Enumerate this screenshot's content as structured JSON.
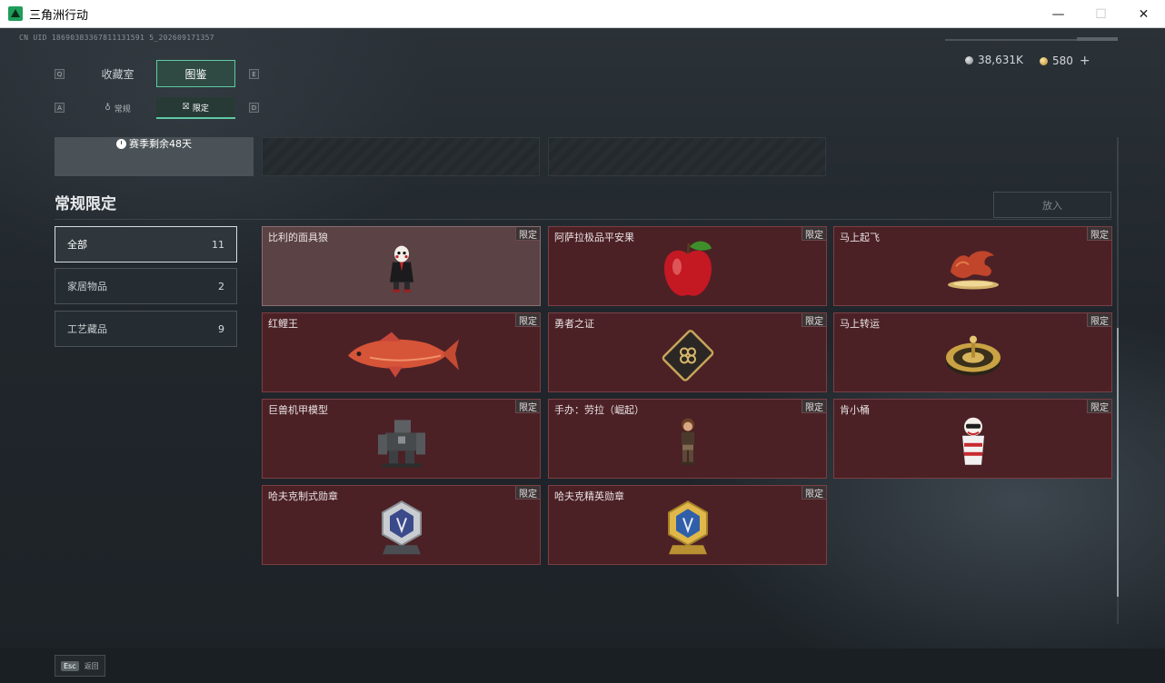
{
  "window": {
    "title": "三角洲行动",
    "minimize": "—",
    "maximize": "☐",
    "close": "✕"
  },
  "uid": "CN UID 18690383367811131591 5_202609171357",
  "currency": {
    "silver": "38,631K",
    "gold": "580",
    "plus": "+"
  },
  "tabs": {
    "key_left": "Q",
    "key_right": "E",
    "collection": "收藏室",
    "catalog": "图鉴"
  },
  "subtabs": {
    "key_left": "A",
    "key_right": "D",
    "regular": "常规",
    "limited": "限定"
  },
  "banner": {
    "season": "赛季剩余48天"
  },
  "section": {
    "title": "常规限定",
    "place_button": "放入"
  },
  "filters": [
    {
      "label": "全部",
      "count": "11"
    },
    {
      "label": "家居物品",
      "count": "2"
    },
    {
      "label": "工艺藏品",
      "count": "9"
    }
  ],
  "tag_label": "限定",
  "items": [
    {
      "name": "比利的面具狼"
    },
    {
      "name": "阿萨拉极品平安果"
    },
    {
      "name": "马上起飞"
    },
    {
      "name": "红鲤王"
    },
    {
      "name": "勇者之证"
    },
    {
      "name": "马上转运"
    },
    {
      "name": "巨兽机甲模型"
    },
    {
      "name": "手办：劳拉（崛起）"
    },
    {
      "name": "肯小桶"
    },
    {
      "name": "哈夫克制式勋章"
    },
    {
      "name": "哈夫克精英勋章"
    }
  ],
  "footer": {
    "esc_key": "Esc",
    "back": "返回"
  },
  "colors": {
    "accent": "#5fc9a4",
    "card_bg": "#4b2126",
    "card_hover": "#5b4244"
  }
}
